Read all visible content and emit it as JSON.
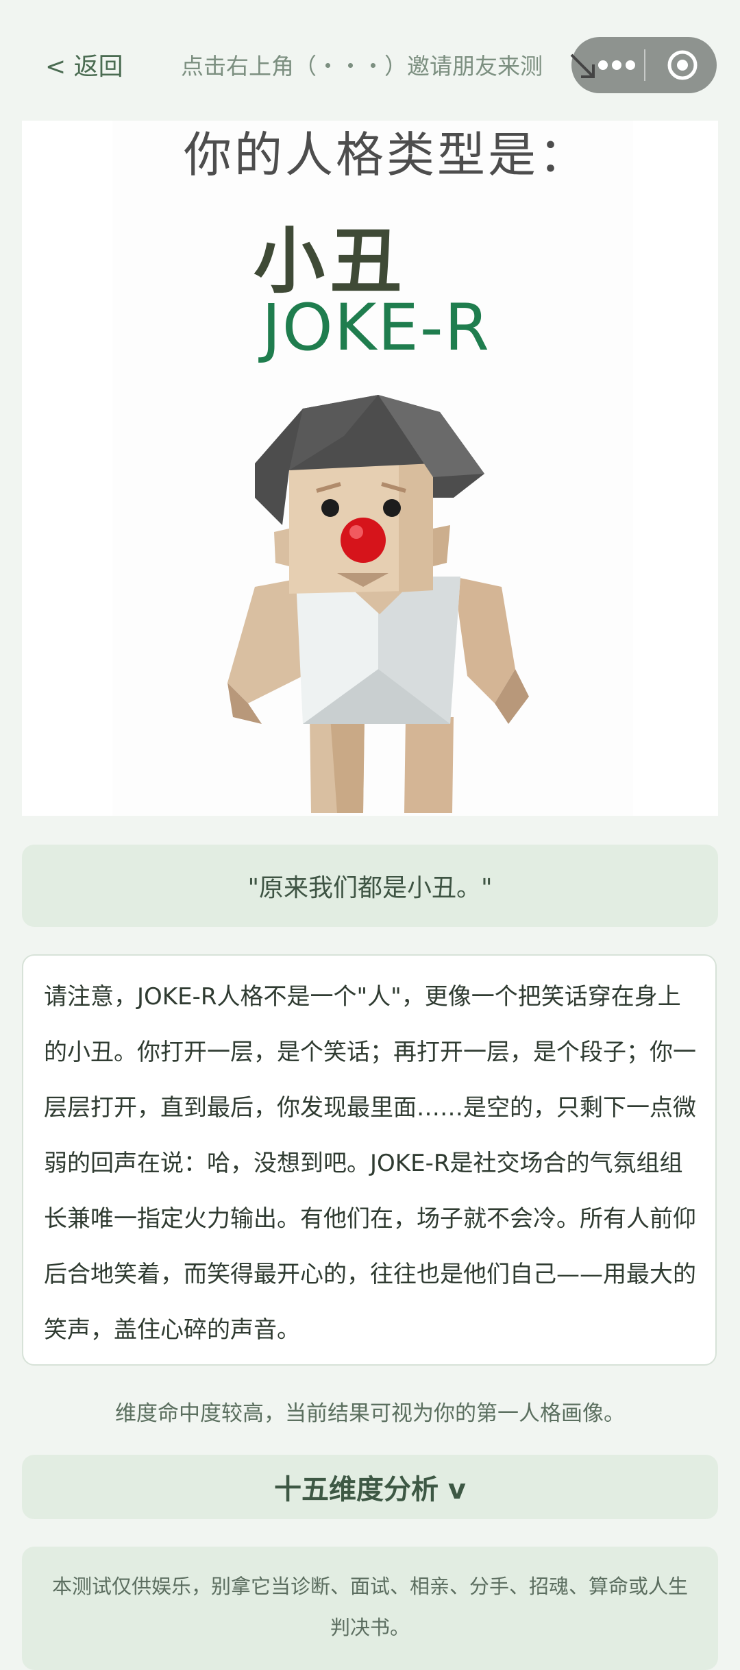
{
  "header": {
    "back_label": "< 返回",
    "hint": "点击右上角（・・・）邀请朋友来测"
  },
  "hero": {
    "heading": "你的人格类型是：",
    "type_name": "小丑",
    "type_code": "JOKE-R"
  },
  "quote": "\"原来我们都是小丑。\"",
  "description": "请注意，JOKE-R人格不是一个\"人\"，更像一个把笑话穿在身上的小丑。你打开一层，是个笑话；再打开一层，是个段子；你一层层打开，直到最后，你发现最里面……是空的，只剩下一点微弱的回声在说：哈，没想到吧。JOKE-R是社交场合的气氛组组长兼唯一指定火力输出。有他们在，场子就不会冷。所有人前仰后合地笑着，而笑得最开心的，往往也是他们自己——用最大的笑声，盖住心碎的声音。",
  "note": "维度命中度较高，当前结果可视为你的第一人格画像。",
  "analysis_toggle": "十五维度分析 v",
  "disclaimer": "本测试仅供娱乐，别拿它当诊断、面试、相亲、分手、招魂、算命或人生判决书。",
  "icons": {
    "back": "chevron-left-icon",
    "more": "more-dots-icon",
    "close": "target-close-icon",
    "arrow": "arrow-down-right-icon"
  },
  "colors": {
    "background": "#f1f5f1",
    "card_green": "#e2ede2",
    "brand_green": "#1f7d4e",
    "clown_nose": "#e0161d"
  }
}
